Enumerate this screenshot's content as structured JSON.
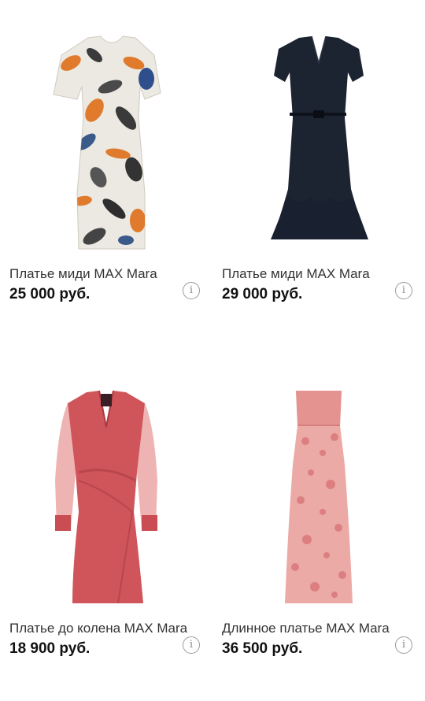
{
  "products": [
    {
      "title": "Платье миди MAX Mara",
      "price": "25 000 руб.",
      "info_icon": "i"
    },
    {
      "title": "Платье миди MAX Mara",
      "price": "29 000 руб.",
      "info_icon": "i"
    },
    {
      "title": "Платье до колена MAX Mara",
      "price": "18 900 руб.",
      "info_icon": "i"
    },
    {
      "title": "Длинное платье MAX Mara",
      "price": "36 500 руб.",
      "info_icon": "i"
    }
  ],
  "colors": {
    "floral_base": "#e9e6df",
    "navy_dress": "#1b2230",
    "coral_dress": "#d0565a",
    "pink_dress": "#e7a2a0"
  }
}
